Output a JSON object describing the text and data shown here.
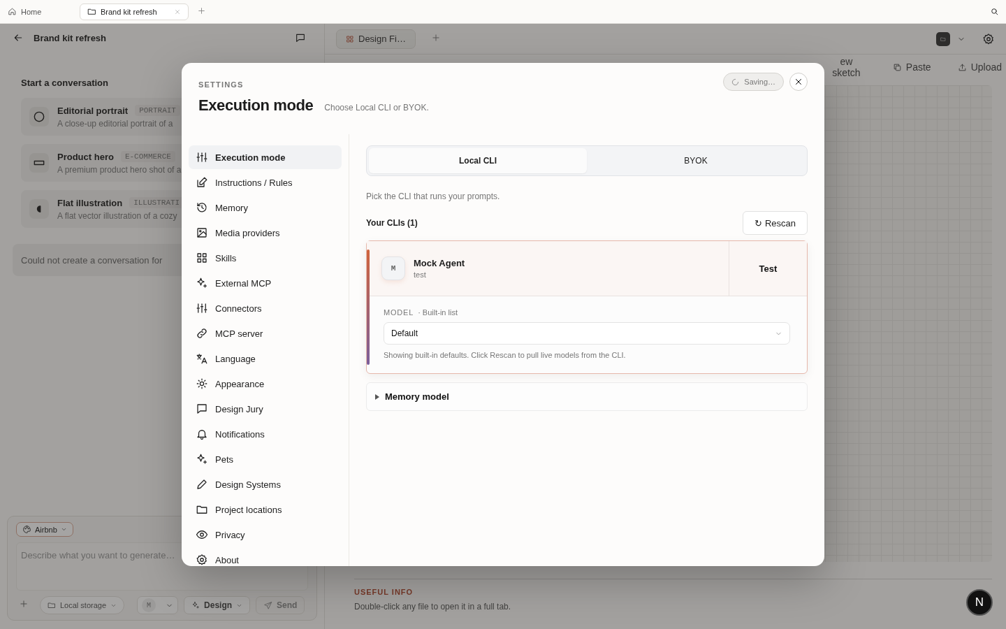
{
  "tabs": [
    {
      "label": "Home",
      "selected": false
    },
    {
      "label": "Brand kit refresh",
      "selected": true
    }
  ],
  "project": {
    "title": "Brand kit refresh",
    "section_title": "Start a conversation",
    "templates": [
      {
        "title": "Editorial portrait",
        "tag": "PORTRAIT",
        "description": "A close-up editorial portrait of a"
      },
      {
        "title": "Product hero",
        "tag": "E-COMMERCE",
        "description": "A premium product hero shot of a"
      },
      {
        "title": "Flat illustration",
        "tag": "ILLUSTRATI",
        "description": "A flat vector illustration of a cozy"
      }
    ],
    "error": "Could not create a conversation for",
    "composer": {
      "design_system": "Airbnb",
      "placeholder": "Describe what you want to generate…",
      "storage": "Local storage",
      "agent_initial": "M",
      "mode": "Design",
      "send": "Send"
    }
  },
  "workspace": {
    "file_tabs": [
      {
        "label": "Design Fi…",
        "selected": true
      }
    ],
    "toolbar": [
      "ew sketch",
      "Paste",
      "Upload"
    ],
    "info_title": "USEFUL INFO",
    "info_text": "Double-click any file to open it in a full tab.",
    "badge": "N"
  },
  "settings": {
    "eyebrow": "SETTINGS",
    "title": "Execution mode",
    "subtitle": "Choose Local CLI or BYOK.",
    "status": "Saving…",
    "nav": [
      {
        "label": "Execution mode",
        "selected": true
      },
      {
        "label": "Instructions / Rules",
        "selected": false
      },
      {
        "label": "Memory",
        "selected": false
      },
      {
        "label": "Media providers",
        "selected": false
      },
      {
        "label": "Skills",
        "selected": false
      },
      {
        "label": "External MCP",
        "selected": false
      },
      {
        "label": "Connectors",
        "selected": false
      },
      {
        "label": "MCP server",
        "selected": false
      },
      {
        "label": "Language",
        "selected": false
      },
      {
        "label": "Appearance",
        "selected": false
      },
      {
        "label": "Design Jury",
        "selected": false
      },
      {
        "label": "Notifications",
        "selected": false
      },
      {
        "label": "Pets",
        "selected": false
      },
      {
        "label": "Design Systems",
        "selected": false
      },
      {
        "label": "Project locations",
        "selected": false
      },
      {
        "label": "Privacy",
        "selected": false
      },
      {
        "label": "About",
        "selected": false
      }
    ],
    "modes": [
      {
        "label": "Local CLI",
        "selected": true
      },
      {
        "label": "BYOK",
        "selected": false
      }
    ],
    "hint": "Pick the CLI that runs your prompts.",
    "clis_heading": "Your CLIs (1)",
    "rescan": "↻ Rescan",
    "clis": [
      {
        "initial": "M",
        "name": "Mock Agent",
        "detail": "test",
        "selected": true,
        "test": "Test",
        "model_label": "MODEL",
        "model_source": "· Built-in list",
        "model": "Default",
        "model_note": "Showing built-in defaults. Click Rescan to pull live models from the CLI."
      }
    ],
    "memory": {
      "label": "Memory model",
      "expanded": false
    }
  }
}
